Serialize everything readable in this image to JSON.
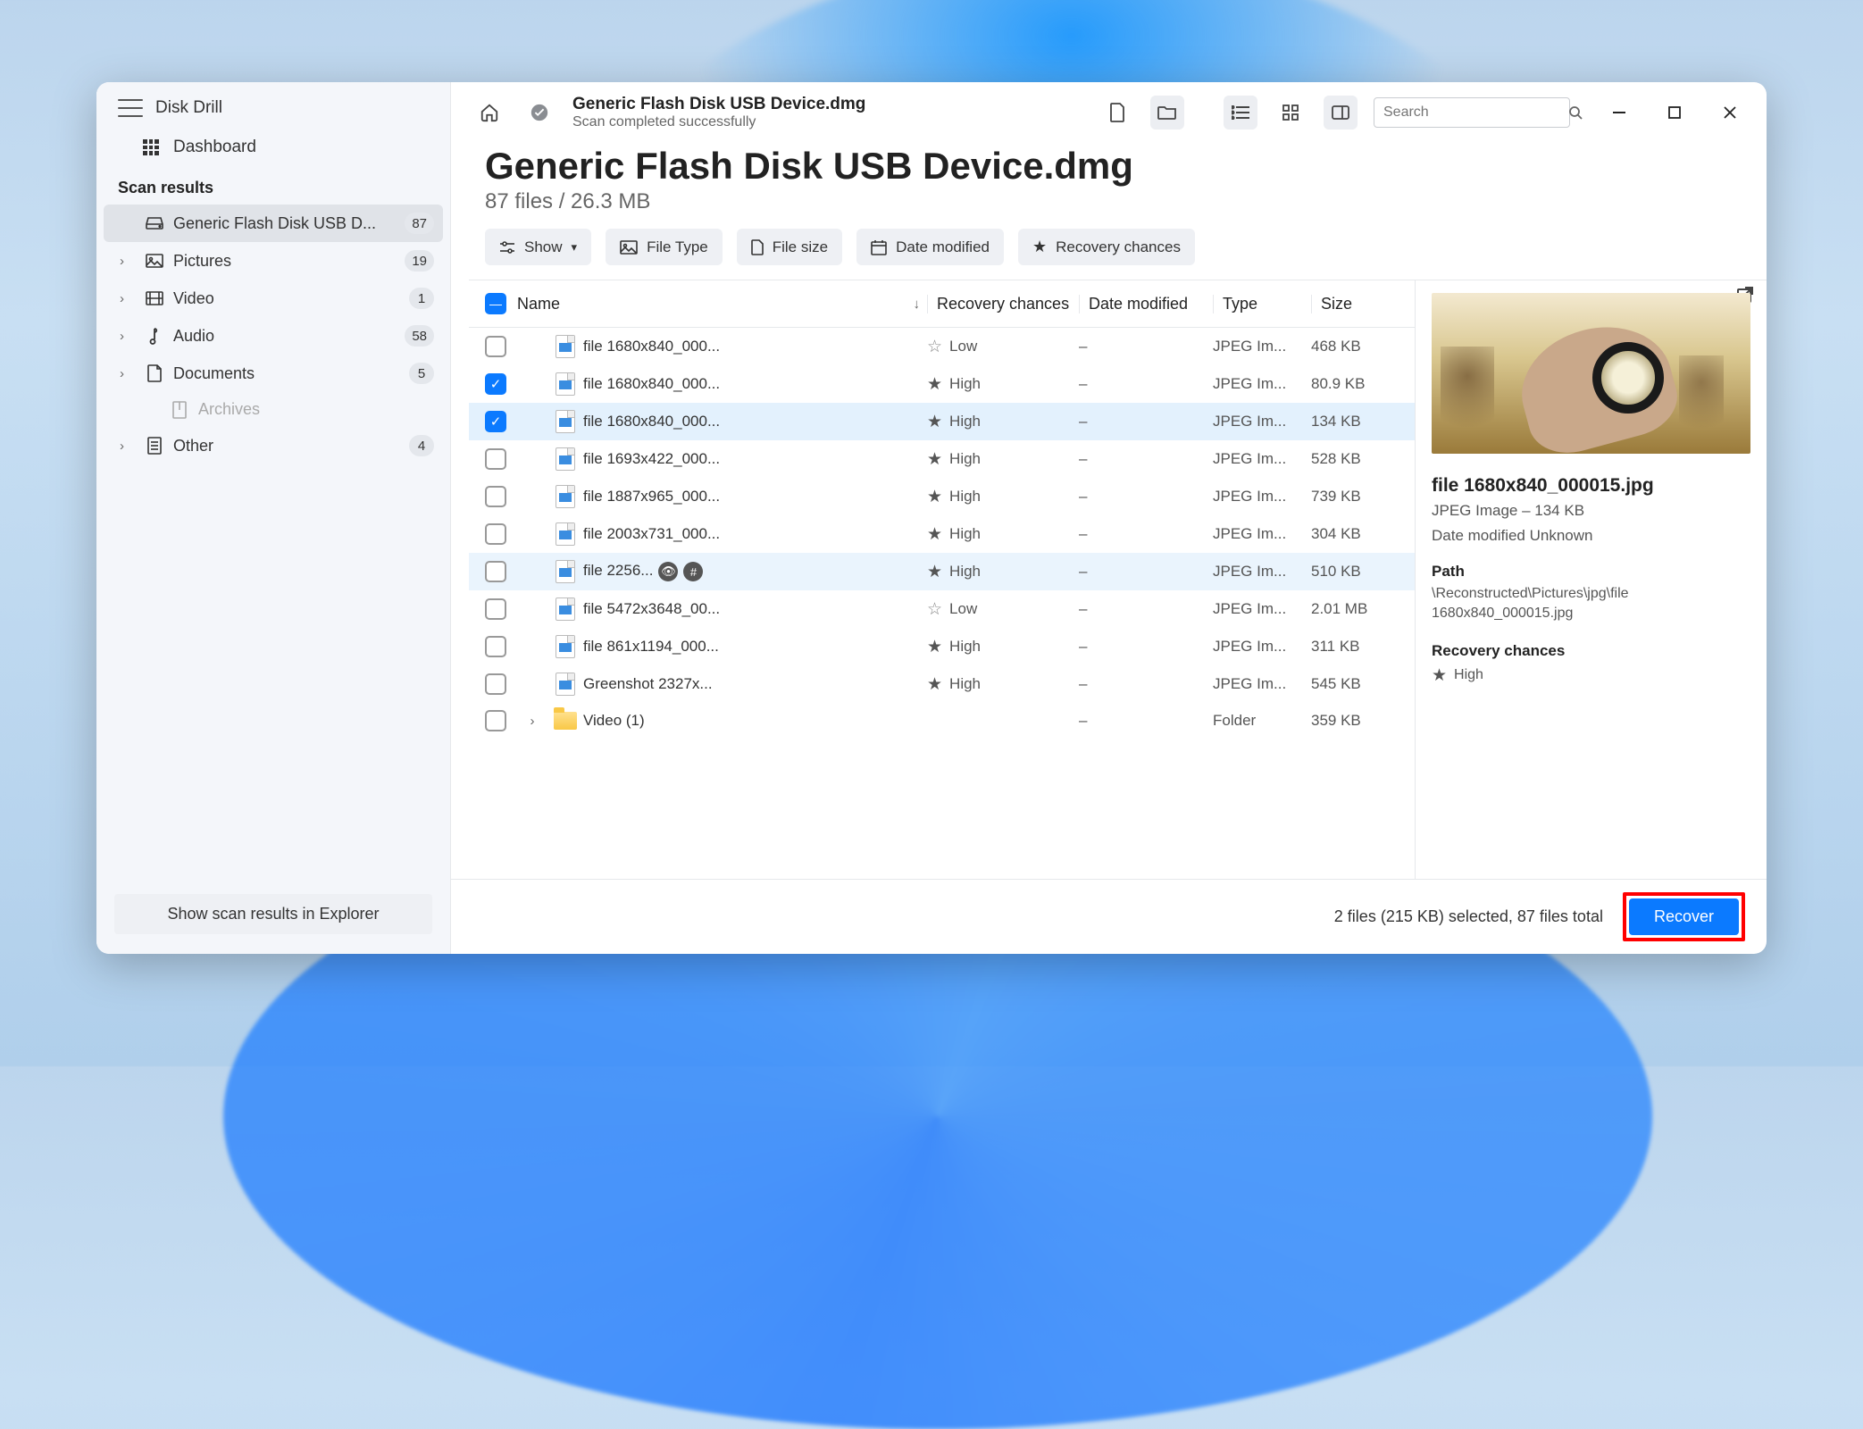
{
  "app": {
    "title": "Disk Drill"
  },
  "sidebar": {
    "dashboard": "Dashboard",
    "section": "Scan results",
    "items": [
      {
        "icon": "drive",
        "label": "Generic Flash Disk USB D...",
        "count": "87",
        "selected": true,
        "chev": false
      },
      {
        "icon": "picture",
        "label": "Pictures",
        "count": "19",
        "chev": true
      },
      {
        "icon": "video",
        "label": "Video",
        "count": "1",
        "chev": true
      },
      {
        "icon": "audio",
        "label": "Audio",
        "count": "58",
        "chev": true
      },
      {
        "icon": "document",
        "label": "Documents",
        "count": "5",
        "chev": true
      },
      {
        "icon": "archive",
        "label": "Archives",
        "count": "",
        "chev": false,
        "dim": true,
        "indent": true
      },
      {
        "icon": "other",
        "label": "Other",
        "count": "4",
        "chev": true
      }
    ],
    "explorer_btn": "Show scan results in Explorer"
  },
  "header": {
    "title": "Generic Flash Disk USB Device.dmg",
    "subtitle": "Scan completed successfully",
    "search_placeholder": "Search"
  },
  "main": {
    "title": "Generic Flash Disk USB Device.dmg",
    "subtitle": "87 files / 26.3 MB",
    "filters": [
      {
        "icon": "sliders",
        "label": "Show",
        "chev": true
      },
      {
        "icon": "picture",
        "label": "File Type"
      },
      {
        "icon": "file",
        "label": "File size"
      },
      {
        "icon": "calendar",
        "label": "Date modified"
      },
      {
        "icon": "star",
        "label": "Recovery chances"
      }
    ],
    "columns": {
      "name": "Name",
      "recovery": "Recovery chances",
      "date": "Date modified",
      "type": "Type",
      "size": "Size"
    },
    "rows": [
      {
        "name": "file 1680x840_000...",
        "rec": "Low",
        "date": "–",
        "type": "JPEG Im...",
        "size": "468 KB",
        "checked": false
      },
      {
        "name": "file 1680x840_000...",
        "rec": "High",
        "date": "–",
        "type": "JPEG Im...",
        "size": "80.9 KB",
        "checked": true
      },
      {
        "name": "file 1680x840_000...",
        "rec": "High",
        "date": "–",
        "type": "JPEG Im...",
        "size": "134 KB",
        "checked": true,
        "sel": true
      },
      {
        "name": "file 1693x422_000...",
        "rec": "High",
        "date": "–",
        "type": "JPEG Im...",
        "size": "528 KB",
        "checked": false
      },
      {
        "name": "file 1887x965_000...",
        "rec": "High",
        "date": "–",
        "type": "JPEG Im...",
        "size": "739 KB",
        "checked": false
      },
      {
        "name": "file 2003x731_000...",
        "rec": "High",
        "date": "–",
        "type": "JPEG Im...",
        "size": "304 KB",
        "checked": false
      },
      {
        "name": "file 2256...",
        "rec": "High",
        "date": "–",
        "type": "JPEG Im...",
        "size": "510 KB",
        "checked": false,
        "hov": true,
        "tags": true
      },
      {
        "name": "file 5472x3648_00...",
        "rec": "Low",
        "date": "–",
        "type": "JPEG Im...",
        "size": "2.01 MB",
        "checked": false
      },
      {
        "name": "file 861x1194_000...",
        "rec": "High",
        "date": "–",
        "type": "JPEG Im...",
        "size": "311 KB",
        "checked": false
      },
      {
        "name": "Greenshot 2327x...",
        "rec": "High",
        "date": "–",
        "type": "JPEG Im...",
        "size": "545 KB",
        "checked": false
      },
      {
        "name": "Video (1)",
        "rec": "",
        "date": "–",
        "type": "Folder",
        "size": "359 KB",
        "checked": false,
        "folder": true,
        "exp": true
      }
    ]
  },
  "preview": {
    "title": "file 1680x840_000015.jpg",
    "subtitle": "JPEG Image – 134 KB",
    "date": "Date modified Unknown",
    "path_h": "Path",
    "path": "\\Reconstructed\\Pictures\\jpg\\file 1680x840_000015.jpg",
    "rec_h": "Recovery chances",
    "rec": "High"
  },
  "footer": {
    "status": "2 files (215 KB) selected, 87 files total",
    "recover": "Recover"
  }
}
